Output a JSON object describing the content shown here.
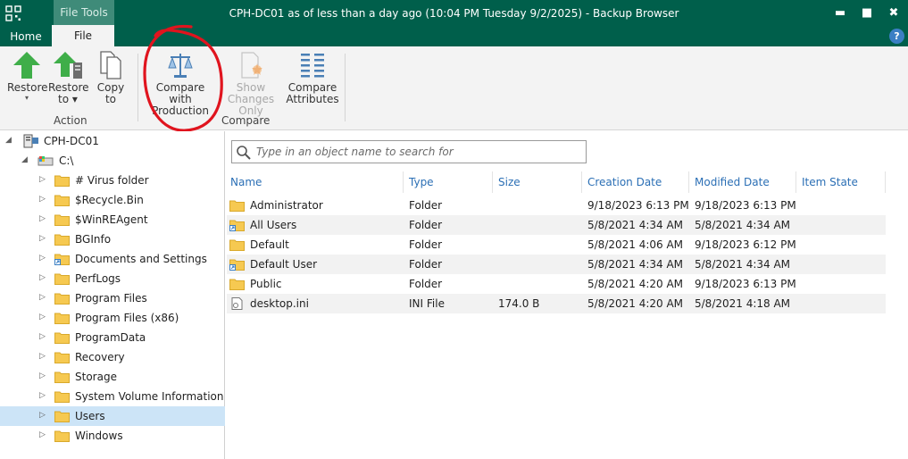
{
  "titlebar": {
    "context_tab": "File Tools",
    "title": "CPH-DC01 as of less than a day ago (10:04 PM Tuesday 9/2/2025) - Backup Browser",
    "minimize": "▬",
    "maximize": "■",
    "close": "✖"
  },
  "tabs": {
    "home": "Home",
    "file": "File",
    "help": "?"
  },
  "ribbon": {
    "action": {
      "label": "Action",
      "restore": {
        "line1": "Restore",
        "caret": "▾"
      },
      "restore_to": {
        "line1": "Restore",
        "line2": "to ▾"
      },
      "copy_to": {
        "line1": "Copy",
        "line2": "to"
      }
    },
    "compare": {
      "label": "Compare",
      "compare_with_production": {
        "line1": "Compare with",
        "line2": "Production"
      },
      "show_changes_only": {
        "line1": "Show",
        "line2": "Changes Only"
      },
      "compare_attributes": {
        "line1": "Compare",
        "line2": "Attributes"
      }
    }
  },
  "tree": {
    "root": "CPH-DC01",
    "drive": "C:\\",
    "folders": [
      {
        "name": "# Virus folder",
        "selected": false,
        "shortcut": false
      },
      {
        "name": "$Recycle.Bin",
        "selected": false,
        "shortcut": false
      },
      {
        "name": "$WinREAgent",
        "selected": false,
        "shortcut": false
      },
      {
        "name": "BGInfo",
        "selected": false,
        "shortcut": false
      },
      {
        "name": "Documents and Settings",
        "selected": false,
        "shortcut": true
      },
      {
        "name": "PerfLogs",
        "selected": false,
        "shortcut": false
      },
      {
        "name": "Program Files",
        "selected": false,
        "shortcut": false
      },
      {
        "name": "Program Files (x86)",
        "selected": false,
        "shortcut": false
      },
      {
        "name": "ProgramData",
        "selected": false,
        "shortcut": false
      },
      {
        "name": "Recovery",
        "selected": false,
        "shortcut": false
      },
      {
        "name": "Storage",
        "selected": false,
        "shortcut": false
      },
      {
        "name": "System Volume Information",
        "selected": false,
        "shortcut": false
      },
      {
        "name": "Users",
        "selected": true,
        "shortcut": false
      },
      {
        "name": "Windows",
        "selected": false,
        "shortcut": false
      }
    ]
  },
  "search": {
    "placeholder": "Type in an object name to search for",
    "value": ""
  },
  "grid": {
    "columns": [
      "Name",
      "Type",
      "Size",
      "Creation Date",
      "Modified Date",
      "Item State"
    ],
    "rows": [
      {
        "name": "Administrator",
        "type": "Folder",
        "size": "",
        "created": "9/18/2023 6:13 PM",
        "modified": "9/18/2023 6:13 PM",
        "state": "",
        "icon": "folder"
      },
      {
        "name": "All Users",
        "type": "Folder",
        "size": "",
        "created": "5/8/2021 4:34 AM",
        "modified": "5/8/2021 4:34 AM",
        "state": "",
        "icon": "shortcut"
      },
      {
        "name": "Default",
        "type": "Folder",
        "size": "",
        "created": "5/8/2021 4:06 AM",
        "modified": "9/18/2023 6:12 PM",
        "state": "",
        "icon": "folder"
      },
      {
        "name": "Default User",
        "type": "Folder",
        "size": "",
        "created": "5/8/2021 4:34 AM",
        "modified": "5/8/2021 4:34 AM",
        "state": "",
        "icon": "shortcut"
      },
      {
        "name": "Public",
        "type": "Folder",
        "size": "",
        "created": "5/8/2021 4:20 AM",
        "modified": "9/18/2023 6:13 PM",
        "state": "",
        "icon": "folder"
      },
      {
        "name": "desktop.ini",
        "type": "INI File",
        "size": "174.0 B",
        "created": "5/8/2021 4:20 AM",
        "modified": "5/8/2021 4:18 AM",
        "state": "",
        "icon": "file"
      }
    ]
  },
  "colors": {
    "titlebar": "#005f4b",
    "accent_green": "#3fae49",
    "selection": "#cce4f7",
    "header_text": "#2b6fb5",
    "annotation": "#e0141e"
  }
}
